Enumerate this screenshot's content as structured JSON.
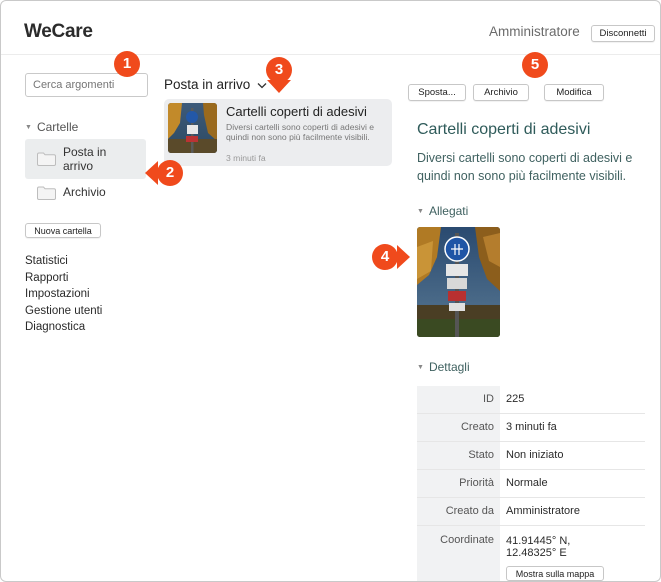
{
  "header": {
    "logo": "WeCare",
    "user_name": "Amministratore",
    "logout_label": "Disconnetti"
  },
  "sidebar": {
    "search_placeholder": "Cerca argomenti",
    "folders_heading": "Cartelle",
    "folders": [
      {
        "label": "Posta in arrivo",
        "active": true
      },
      {
        "label": "Archivio",
        "active": false
      }
    ],
    "new_folder_label": "Nuova cartella",
    "links": [
      "Statistici",
      "Rapporti",
      "Impostazioni",
      "Gestione utenti",
      "Diagnostica"
    ]
  },
  "inbox": {
    "title": "Posta in arrivo",
    "items": [
      {
        "title": "Cartelli coperti di adesivi",
        "description": "Diversi cartelli sono coperti di adesivi e quindi non sono più facilmente visibili.",
        "time": "3 minuti fa"
      }
    ]
  },
  "detail": {
    "actions": {
      "move": "Sposta...",
      "archive": "Archivio",
      "edit": "Modifica"
    },
    "title": "Cartelli coperti di adesivi",
    "description": "Diversi cartelli sono coperti di adesivi e quindi non sono più facilmente visibili.",
    "attachments_heading": "Allegati",
    "details_heading": "Dettagli",
    "rows": [
      {
        "key": "ID",
        "value": "225"
      },
      {
        "key": "Creato",
        "value": "3 minuti fa"
      },
      {
        "key": "Stato",
        "value": "Non iniziato"
      },
      {
        "key": "Priorità",
        "value": "Normale"
      },
      {
        "key": "Creato da",
        "value": "Amministratore"
      }
    ],
    "coords": {
      "key": "Coordinate",
      "lat": "41.91445° N,",
      "lon": "12.48325° E",
      "map_button": "Mostra sulla mappa"
    }
  },
  "callouts": [
    "1",
    "2",
    "3",
    "4",
    "5"
  ],
  "colors": {
    "callout": "#f04a1c",
    "accent_text": "#2f5b5a",
    "active_folder": "#ebedee"
  }
}
